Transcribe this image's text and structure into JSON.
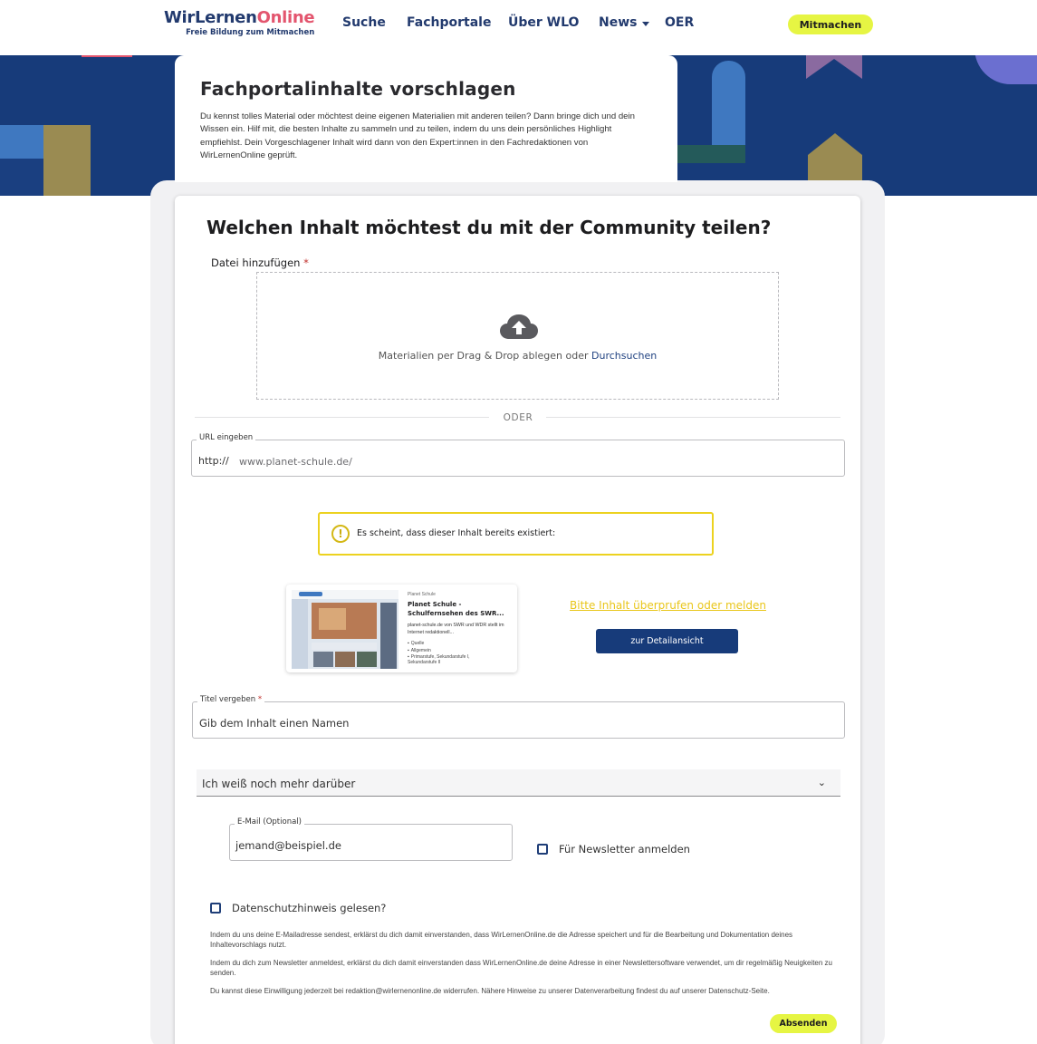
{
  "header": {
    "logo_part1": "WirLernen",
    "logo_part2": "Online",
    "logo_tagline": "Freie Bildung zum Mitmachen",
    "nav": [
      "Suche",
      "Fachportale",
      "Über WLO",
      "News",
      "OER"
    ],
    "join_label": "Mitmachen"
  },
  "intro": {
    "title": "Fachportalinhalte vorschlagen",
    "text": "Du kennst tolles Material oder möchtest deine eigenen Materialien mit anderen teilen? Dann bringe dich und dein Wissen ein. Hilf mit, die besten Inhalte zu sammeln und zu teilen, indem du uns dein persönliches Highlight empfiehlst. Dein Vorgeschlagener Inhalt wird dann von den Expert:innen in den Fachredaktionen von WirLernenOnline geprüft."
  },
  "form": {
    "heading": "Welchen Inhalt möchtest du mit der Community teilen?",
    "file_label": "Datei hinzufügen",
    "required_mark": "*",
    "drop_text": "Materialien per Drag & Drop ablegen oder",
    "drop_link": "Durchsuchen",
    "or_label": "ODER",
    "url_label": "URL eingeben",
    "url_prefix": "http://",
    "url_value": "www.planet-schule.de/",
    "notice_icon": "!",
    "notice_text": "Es scheint, dass dieser Inhalt bereits existiert:",
    "preview": {
      "source": "Planet Schule",
      "title": "Planet Schule - Schulfernsehen des SWR...",
      "description": "planet-schule.de von SWR und WDR stellt im Internet redaktionell...",
      "meta": [
        "Quelle",
        "Allgemein",
        "Primarstufe, Sekundarstufe I, Sekundarstufe II"
      ]
    },
    "report_link": "Bitte Inhalt überprufen oder melden",
    "detail_button": "zur Detailansicht",
    "title_label": "Titel vergeben",
    "title_value": "Gib dem Inhalt einen Namen",
    "more_label": "Ich weiß noch mehr darüber",
    "email_label": "E-Mail (Optional)",
    "email_value": "jemand@beispiel.de",
    "newsletter_label": "Für Newsletter anmelden",
    "privacy_label": "Datenschutzhinweis gelesen?",
    "legal": [
      "Indem du uns deine E-Mailadresse sendest, erklärst du dich damit einverstanden, dass WirLernenOnline.de die Adresse speichert und für die Bearbeitung und Dokumentation deines Inhaltevorschlags nutzt.",
      "Indem du dich zum Newsletter anmeldest, erklärst du dich damit einverstanden dass WirLernenOnline.de deine Adresse in einer Newslettersoftware verwendet, um dir regelmäßig Neuigkeiten zu senden.",
      "Du kannst diese Einwilligung jederzeit bei redaktion@wirlernenonline.de widerrufen. Nähere Hinweise zu unserer Datenverarbeitung findest du auf unserer Datenschutz-Seite."
    ],
    "submit_label": "Absenden"
  },
  "colors": {
    "brand_blue": "#173b7a",
    "accent_yellow": "#e6f543",
    "warning_yellow": "#ecd21f",
    "logo_pink": "#e3556e"
  }
}
